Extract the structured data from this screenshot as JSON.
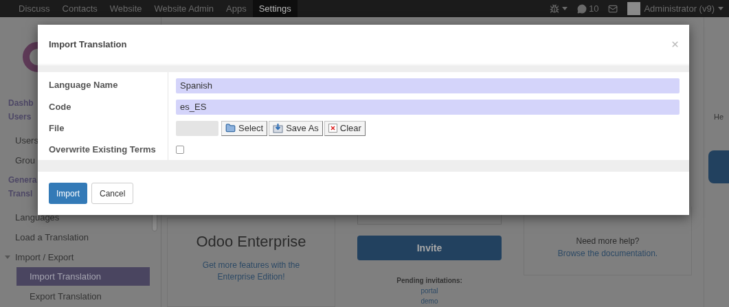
{
  "navbar": {
    "menu": [
      {
        "label": "Discuss",
        "selected": false
      },
      {
        "label": "Contacts",
        "selected": false
      },
      {
        "label": "Website",
        "selected": false
      },
      {
        "label": "Website Admin",
        "selected": false
      },
      {
        "label": "Apps",
        "selected": false
      },
      {
        "label": "Settings",
        "selected": true
      }
    ],
    "messages_count": "10",
    "user": "Administrator (v9)"
  },
  "sidebar": {
    "items": [
      {
        "kind": "heading",
        "label": "Dashb"
      },
      {
        "kind": "heading",
        "label": "Users"
      },
      {
        "kind": "item",
        "label": "Users",
        "selected": false
      },
      {
        "kind": "item",
        "label": "Grou",
        "selected": false
      },
      {
        "kind": "heading",
        "label": "Genera"
      },
      {
        "kind": "heading",
        "label": "Transl"
      },
      {
        "kind": "item",
        "label": "Languages",
        "selected": false
      },
      {
        "kind": "item",
        "label": "Load a Translation",
        "selected": false
      },
      {
        "kind": "parent",
        "label": "Import / Export",
        "expanded": true,
        "children": [
          {
            "label": "Import Translation",
            "selected": true
          },
          {
            "label": "Export Translation",
            "selected": false
          }
        ]
      }
    ]
  },
  "dashboard": {
    "enterprise": {
      "title": "Odoo Enterprise",
      "link": "Get more features with the Enterprise Edition!"
    },
    "invite": {
      "button": "Invite",
      "pending_label": "Pending invitations:",
      "pending": [
        "portal",
        "demo"
      ]
    },
    "help": {
      "text": "Need more help?",
      "link": "Browse the documentation."
    },
    "column_4": {
      "text": "He"
    }
  },
  "modal": {
    "title": "Import Translation",
    "fields": [
      {
        "kind": "text",
        "label": "Language Name",
        "value": "Spanish"
      },
      {
        "kind": "text",
        "label": "Code",
        "value": "es_ES"
      },
      {
        "kind": "file",
        "label": "File",
        "buttons": [
          "Select",
          "Save As",
          "Clear"
        ]
      },
      {
        "kind": "checkbox",
        "label": "Overwrite Existing Terms",
        "checked": false
      }
    ],
    "buttons": [
      {
        "label": "Import",
        "primary": true
      },
      {
        "label": "Cancel",
        "primary": false
      }
    ]
  }
}
